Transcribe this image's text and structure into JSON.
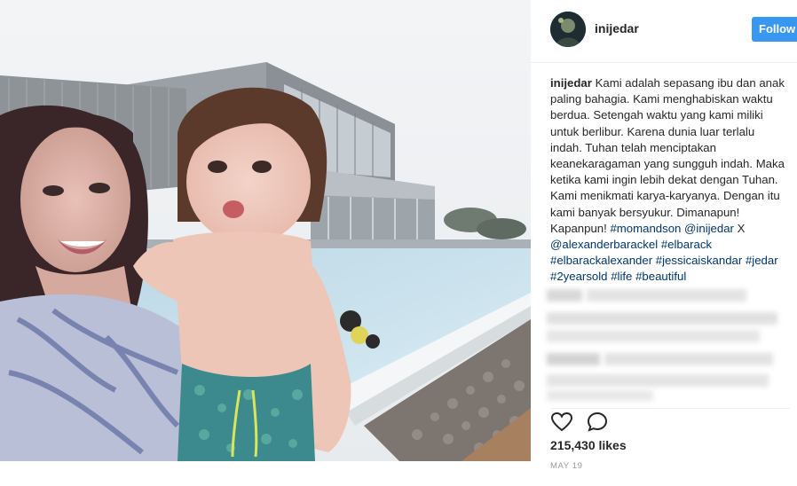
{
  "post": {
    "username": "inijedar",
    "follow_label": "Follow",
    "caption": {
      "username": "inijedar",
      "text": "Kami adalah sepasang ibu dan anak paling bahagia. Kami menghabiskan waktu berdua. Setengah waktu yang kami miliki untuk berlibur. Karena dunia luar terlalu indah. Tuhan telah menciptakan keanekaragaman yang sungguh indah. Maka ketika kami ingin lebih dekat dengan Tuhan. Kami menikmati karya-karyanya. Dengan itu kami banyak bersyukur. Dimanapun! Kapanpun! ",
      "tag_momandson": "#momandson",
      "mention_inijedar": "@inijedar",
      "x_sep": " X ",
      "mention_alexander": "@alexanderbarackel",
      "tag_elbarack": "#elbarack",
      "tag_elbarackalexander": "#elbarackalexander",
      "tag_jessicaiskandar": "#jessicaiskandar",
      "tag_jedar": "#jedar",
      "tag_2yearsold": "#2yearsold",
      "tag_life": "#life",
      "tag_beautiful": "#beautiful"
    },
    "likes": "215,430 likes",
    "date": "MAY 19"
  },
  "icons": {
    "like": "heart-outline-icon",
    "comment": "comment-bubble-icon"
  },
  "colors": {
    "follow_button": "#3897f0",
    "hashtag": "#003569",
    "date": "#999999"
  }
}
